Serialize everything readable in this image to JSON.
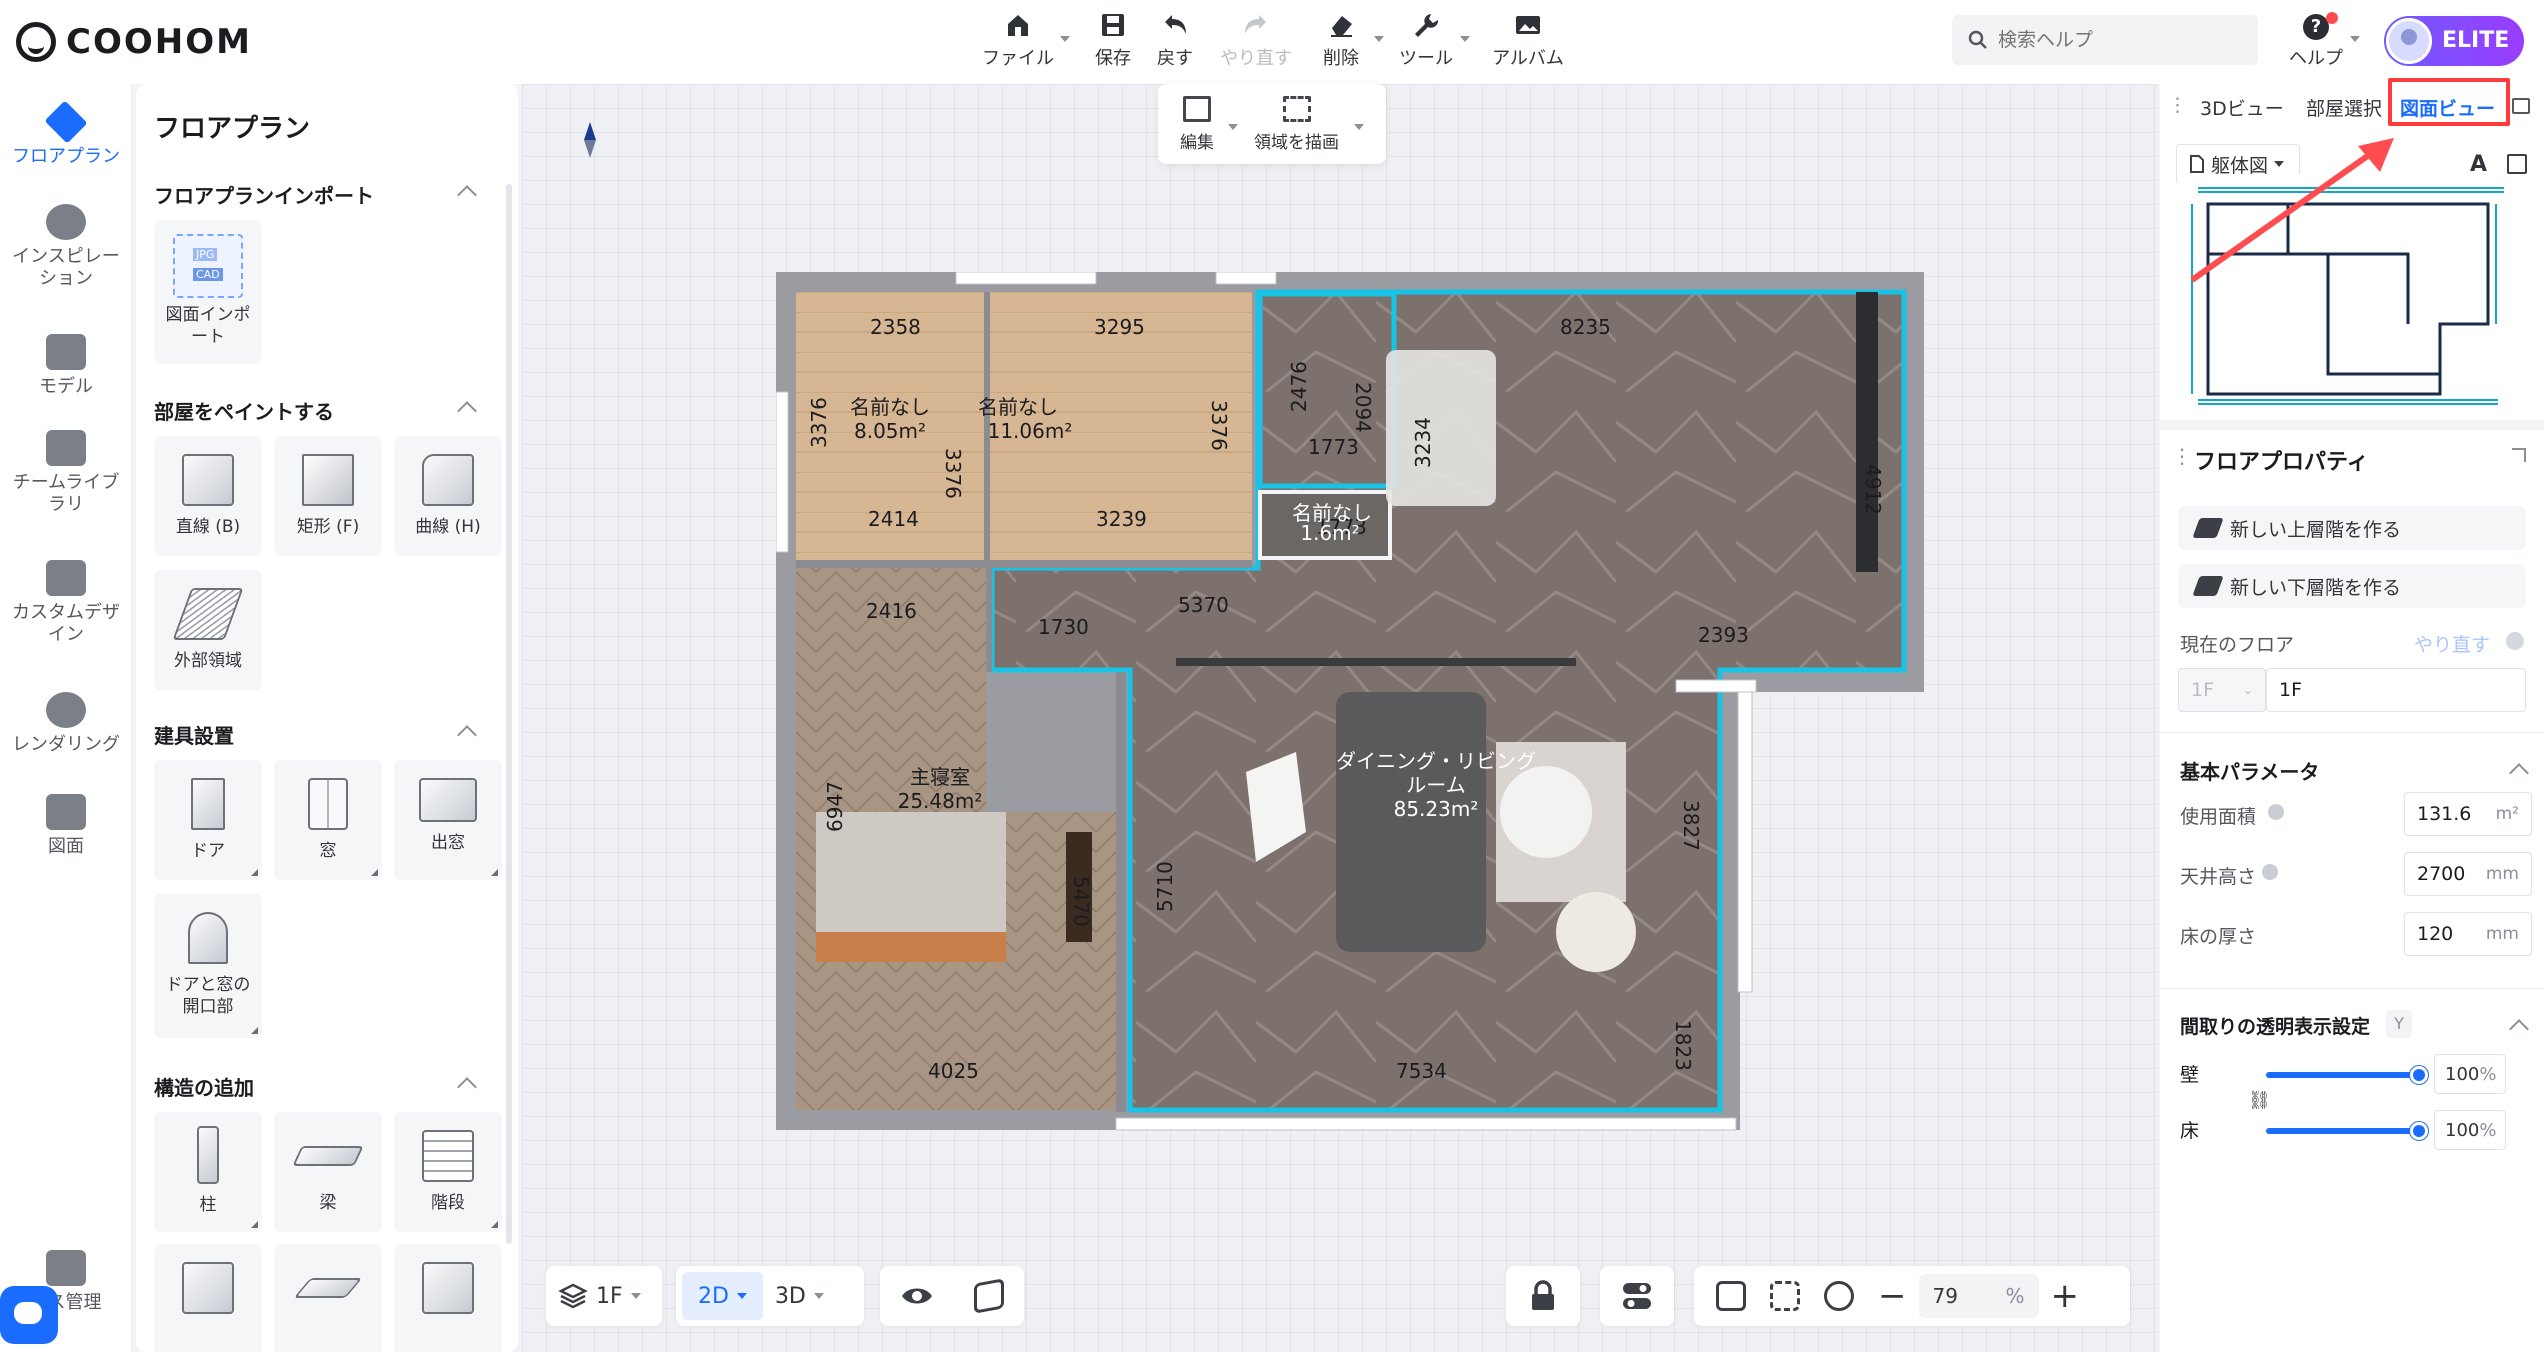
{
  "app": {
    "brand": "COOHOM"
  },
  "toolbar": [
    {
      "id": "file",
      "label": "ファイル",
      "icon": "home-icon",
      "dropdown": true
    },
    {
      "id": "save",
      "label": "保存",
      "icon": "save-icon"
    },
    {
      "id": "undo",
      "label": "戻す",
      "icon": "undo-icon"
    },
    {
      "id": "redo",
      "label": "やり直す",
      "icon": "redo-icon",
      "disabled": true
    },
    {
      "id": "delete",
      "label": "削除",
      "icon": "eraser-icon",
      "dropdown": true
    },
    {
      "id": "tools",
      "label": "ツール",
      "icon": "wrench-icon",
      "dropdown": true
    },
    {
      "id": "album",
      "label": "アルバム",
      "icon": "image-icon"
    }
  ],
  "search": {
    "placeholder": "検索ヘルプ"
  },
  "help": {
    "label": "ヘルプ"
  },
  "account": {
    "badge": "ELITE"
  },
  "rail": [
    {
      "label": "フロアプラン",
      "active": true
    },
    {
      "label": "インスピレー\nション"
    },
    {
      "label": "モデル"
    },
    {
      "label": "チームライブ\nラリ"
    },
    {
      "label": "カスタムデザ\nイン"
    },
    {
      "label": "レンダリング"
    },
    {
      "label": "図面"
    },
    {
      "label": "ース管理"
    }
  ],
  "catalog": {
    "title": "フロアプラン",
    "sections": [
      {
        "title": "フロアプランインポート",
        "items": [
          "図面インポ\nート"
        ],
        "badges": [
          "JPG",
          "CAD"
        ]
      },
      {
        "title": "部屋をペイントする",
        "items": [
          "直線 (B)",
          "矩形 (F)",
          "曲線 (H)",
          "外部領域"
        ]
      },
      {
        "title": "建具設置",
        "items": [
          "ドア",
          "窓",
          "出窓",
          "ドアと窓の\n開口部"
        ]
      },
      {
        "title": "構造の追加",
        "items": [
          "柱",
          "梁",
          "階段"
        ]
      }
    ]
  },
  "edit_bar": {
    "edit": "編集",
    "draw_region": "領域を描画"
  },
  "plan": {
    "rooms": [
      {
        "name": "名前なし",
        "area": "8.05m²"
      },
      {
        "name": "名前なし",
        "area": "11.06m²"
      },
      {
        "name": "名前なし",
        "area": "1.6m²"
      },
      {
        "name": "主寝室",
        "area": "25.48m²"
      },
      {
        "name": "ダイニング・リビング\nルーム",
        "area": "85.23m²"
      }
    ],
    "dimensions": [
      "2358",
      "3295",
      "8235",
      "3376",
      "3376",
      "3376",
      "2476",
      "2094",
      "1773",
      "3234",
      "4912",
      "2414",
      "3239",
      "1773",
      "2416",
      "1730",
      "5370",
      "2393",
      "6947",
      "5470",
      "5710",
      "3827",
      "1823",
      "4025",
      "7534"
    ]
  },
  "bottom": {
    "floor": "1F",
    "mode_2d": "2D",
    "mode_3d": "3D",
    "zoom": "79",
    "zoom_unit": "%"
  },
  "right": {
    "tabs": [
      "3Dビュー",
      "部屋選択",
      "図面ビュー"
    ],
    "active_tab": "図面ビュー",
    "mini_select": "躯体図",
    "props_title": "フロアプロパティ",
    "add_upper": "新しい上層階を作る",
    "add_lower": "新しい下層階を作る",
    "current_floor_label": "現在のフロア",
    "redo_link": "やり直す",
    "floor_code": "1F",
    "floor_name": "1F",
    "basic_params": "基本パラメータ",
    "usable_area_label": "使用面積",
    "usable_area": "131.6",
    "usable_area_unit": "m²",
    "ceiling_label": "天井高さ",
    "ceiling": "2700",
    "ceiling_unit": "mm",
    "floor_thick_label": "床の厚さ",
    "floor_thick": "120",
    "floor_thick_unit": "mm",
    "transparency_title": "間取りの透明表示設定",
    "transparency_key": "Y",
    "wall_label": "壁",
    "wall_value": "100",
    "floor_label": "床",
    "floor_value": "100",
    "pct_unit": "%"
  },
  "colors": {
    "accent": "#1a6cff",
    "highlight": "#ff3b3b",
    "room_outline": "#19c3e6"
  }
}
